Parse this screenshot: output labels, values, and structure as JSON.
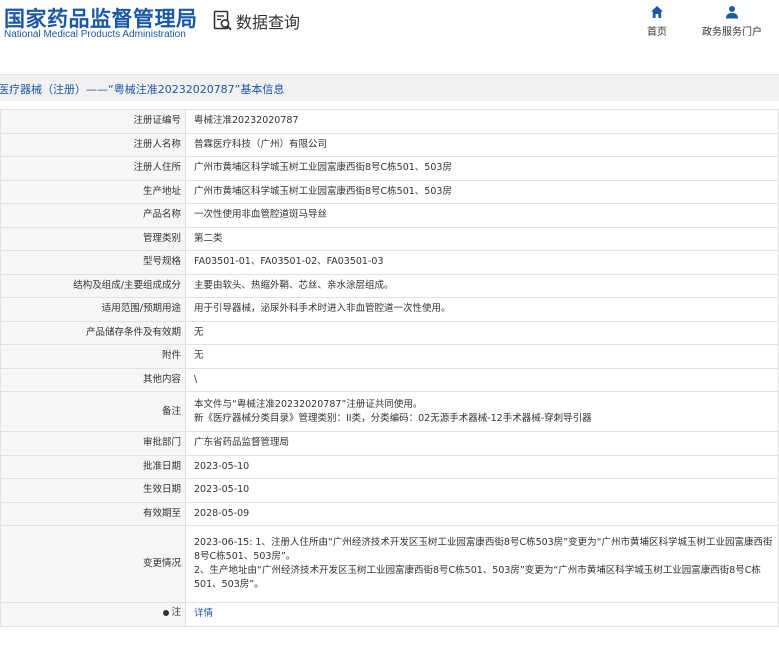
{
  "header": {
    "org_name_cn": "国家药品监督管理局",
    "org_name_en": "National Medical Products Administration",
    "app_title": "数据查询",
    "nav": [
      {
        "label": "首页",
        "icon": "home-icon"
      },
      {
        "label": "政务服务门户",
        "icon": "user-icon"
      }
    ]
  },
  "breadcrumb": "医疗器械（注册）——“粤械注准20232020787”基本信息",
  "colors": {
    "brand": "#1b58a8",
    "label_bg": "#f6f6f6",
    "border": "#e1e1e1"
  },
  "fields": [
    {
      "label": "注册证编号",
      "value": [
        "粤械注准20232020787"
      ]
    },
    {
      "label": "注册人名称",
      "value": [
        "普霖医疗科技（广州）有限公司"
      ]
    },
    {
      "label": "注册人住所",
      "value": [
        "广州市黄埔区科学城玉树工业园富康西街8号C栋501、503房"
      ]
    },
    {
      "label": "生产地址",
      "value": [
        "广州市黄埔区科学城玉树工业园富康西街8号C栋501、503房"
      ]
    },
    {
      "label": "产品名称",
      "value": [
        "一次性使用非血管腔道斑马导丝"
      ]
    },
    {
      "label": "管理类别",
      "value": [
        "第二类"
      ]
    },
    {
      "label": "型号规格",
      "value": [
        "FA03501-01、FA03501-02、FA03501-03"
      ]
    },
    {
      "label": "结构及组成/主要组成成分",
      "value": [
        "主要由软头、热缩外鞘、芯丝、亲水涂层组成。"
      ]
    },
    {
      "label": "适用范围/预期用途",
      "value": [
        "用于引导器械，泌尿外科手术时进入非血管腔道一次性使用。"
      ]
    },
    {
      "label": "产品储存条件及有效期",
      "value": [
        "无"
      ]
    },
    {
      "label": "附件",
      "value": [
        "无"
      ]
    },
    {
      "label": "其他内容",
      "value": [
        "\\"
      ]
    },
    {
      "label": "备注",
      "value": [
        "本文件与“粤械注准20232020787”注册证共同使用。",
        "新《医疗器械分类目录》管理类别：II类，分类编码：02无源手术器械-12手术器械-穿刺导引器"
      ]
    },
    {
      "label": "审批部门",
      "value": [
        "广东省药品监督管理局"
      ]
    },
    {
      "label": "批准日期",
      "value": [
        "2023-05-10"
      ]
    },
    {
      "label": "生效日期",
      "value": [
        "2023-05-10"
      ]
    },
    {
      "label": "有效期至",
      "value": [
        "2028-05-09"
      ]
    },
    {
      "label": "变更情况",
      "value": [
        "2023-06-15: 1、注册人住所由“广州经济技术开发区玉树工业园富康西街8号C栋503房”变更为“广州市黄埔区科学城玉树工业园富康西街8号C栋501、503房”。",
        "2、生产地址由“广州经济技术开发区玉树工业园富康西街8号C栋501、503房”变更为“广州市黄埔区科学城玉树工业园富康西街8号C栋501、503房”。"
      ]
    }
  ],
  "note": {
    "label": "注",
    "link_label": "详情"
  }
}
